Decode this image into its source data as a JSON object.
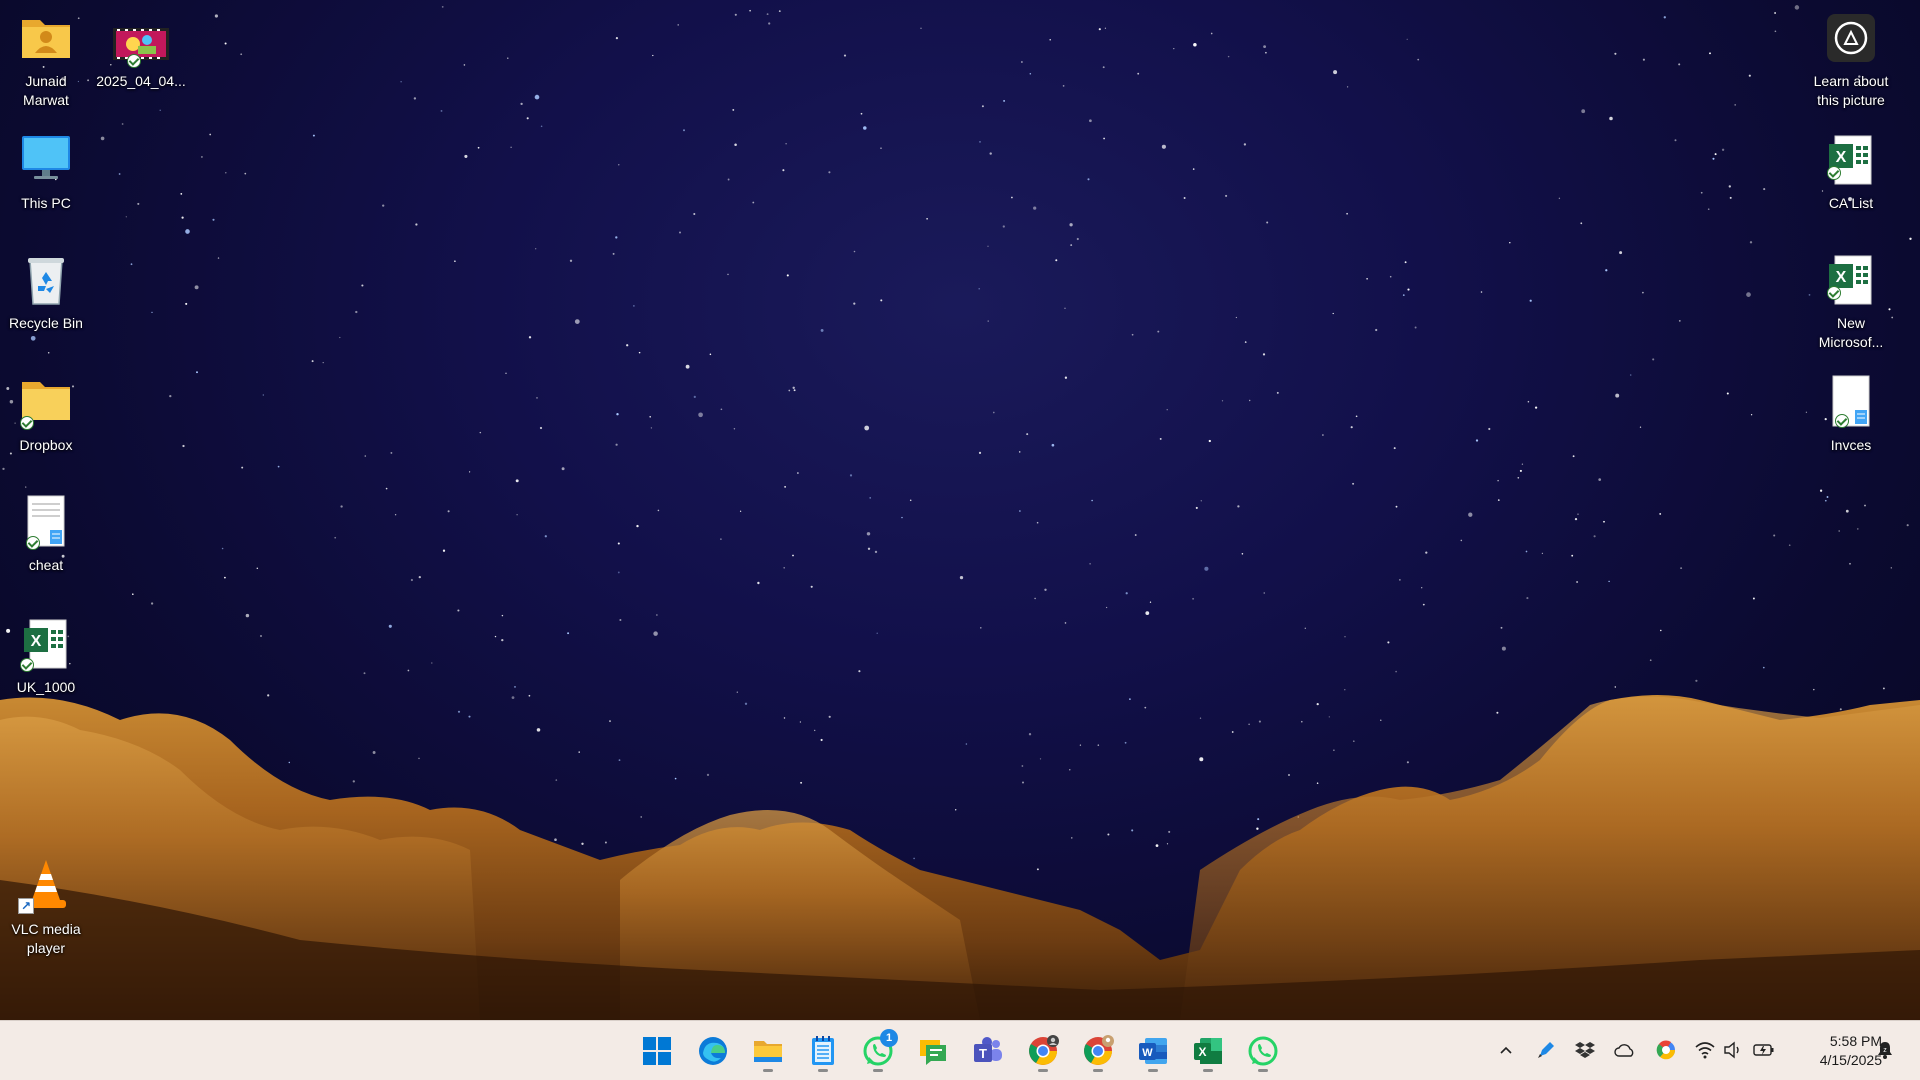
{
  "desktop": {
    "icons_left": [
      {
        "label": "Junaid\nMarwat",
        "icon": "user-folder-icon",
        "synced": false
      },
      {
        "label": "This PC",
        "icon": "monitor-icon",
        "synced": false
      },
      {
        "label": "Recycle Bin",
        "icon": "recycle-bin-icon",
        "synced": false
      },
      {
        "label": "Dropbox",
        "icon": "folder-icon",
        "synced": true
      },
      {
        "label": "cheat",
        "icon": "text-document-icon",
        "synced": true
      },
      {
        "label": "UK_1000",
        "icon": "excel-file-icon",
        "synced": true
      },
      {
        "label": "VLC media\nplayer",
        "icon": "vlc-cone-icon",
        "shortcut": true
      }
    ],
    "video_file": {
      "label": "2025_04_04...",
      "icon": "video-thumbnail-icon",
      "synced": true
    },
    "icons_right": [
      {
        "label": "Learn about\nthis picture",
        "icon": "camera-info-icon"
      },
      {
        "label": "CA List",
        "icon": "excel-file-icon",
        "synced": true
      },
      {
        "label": "New\nMicrosof...",
        "icon": "excel-file-icon",
        "synced": true
      },
      {
        "label": "Invces",
        "icon": "text-document-icon",
        "synced": true
      }
    ]
  },
  "taskbar": {
    "apps": [
      {
        "name": "start",
        "icon": "windows-start-icon"
      },
      {
        "name": "edge",
        "icon": "edge-browser-icon"
      },
      {
        "name": "file-explorer",
        "icon": "file-explorer-icon",
        "running": true
      },
      {
        "name": "notepad",
        "icon": "notepad-icon",
        "running": true
      },
      {
        "name": "whatsapp-1",
        "icon": "whatsapp-icon",
        "running": true,
        "badge": "1"
      },
      {
        "name": "chat",
        "icon": "chat-app-icon"
      },
      {
        "name": "teams",
        "icon": "teams-icon"
      },
      {
        "name": "chrome-1",
        "icon": "chrome-icon",
        "running": true
      },
      {
        "name": "chrome-2",
        "icon": "chrome-icon",
        "running": true
      },
      {
        "name": "word",
        "icon": "word-icon",
        "running": true
      },
      {
        "name": "excel",
        "icon": "excel-icon",
        "running": true
      },
      {
        "name": "whatsapp-2",
        "icon": "whatsapp-icon",
        "running": true
      }
    ],
    "tray": [
      "chevron-up-icon",
      "pen-icon",
      "dropbox-icon",
      "onedrive-icon",
      "google-drive-icon",
      "wifi-icon",
      "speaker-icon",
      "battery-icon"
    ],
    "time": "5:58 PM",
    "date": "4/15/2025",
    "notification_icon": "bell-icon"
  }
}
